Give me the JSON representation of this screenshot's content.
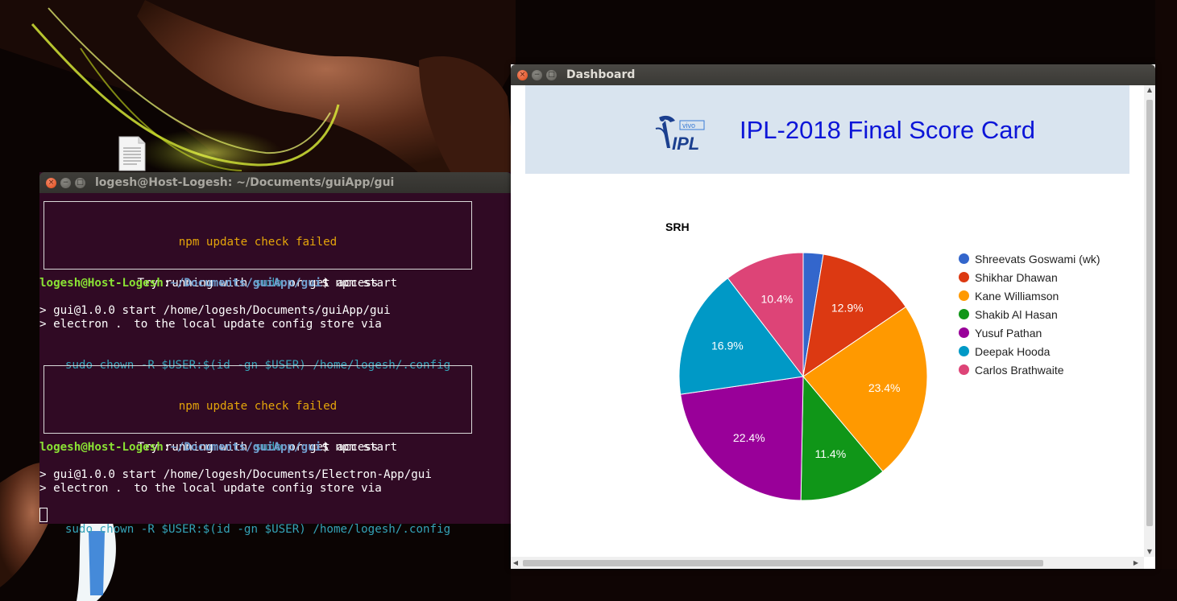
{
  "terminal": {
    "title": "logesh@Host-Logesh: ~/Documents/guiApp/gui",
    "npm_notice": {
      "line1": "npm update check failed",
      "line2_pre": "Try running with ",
      "line2_cmd": "sudo",
      "line2_post": " or get access",
      "line3": "to the local update config store via",
      "line4": "sudo chown -R $USER:$(id -gn $USER) /home/logesh/.config"
    },
    "prompt_user": "logesh@Host-Logesh",
    "prompt_sep": ":",
    "prompt_path": "~/Documents/guiApp/gui",
    "prompt_symbol": "$ npm start",
    "run1_line1": "> gui@1.0.0 start /home/logesh/Documents/guiApp/gui",
    "run1_line2": "> electron .",
    "run2_line1": "> gui@1.0.0 start /home/logesh/Documents/Electron-App/gui",
    "run2_line2": "> electron ."
  },
  "dashboard": {
    "title": "Dashboard",
    "page_title": "IPL-2018 Final Score Card",
    "logo": {
      "brand": "IPL",
      "sponsor": "vivo"
    }
  },
  "chart_data": {
    "type": "pie",
    "title": "SRH",
    "legend_position": "right",
    "series": [
      {
        "name": "Shreevats Goswami (wk)",
        "value": 2.6,
        "label": "",
        "color": "#3366cc"
      },
      {
        "name": "Shikhar Dhawan",
        "value": 12.9,
        "label": "12.9%",
        "color": "#dc3912"
      },
      {
        "name": "Kane Williamson",
        "value": 23.4,
        "label": "23.4%",
        "color": "#ff9900"
      },
      {
        "name": "Shakib Al Hasan",
        "value": 11.4,
        "label": "11.4%",
        "color": "#109618"
      },
      {
        "name": "Yusuf Pathan",
        "value": 22.4,
        "label": "22.4%",
        "color": "#990099"
      },
      {
        "name": "Deepak Hooda",
        "value": 16.9,
        "label": "16.9%",
        "color": "#0099c6"
      },
      {
        "name": "Carlos Brathwaite",
        "value": 10.4,
        "label": "10.4%",
        "color": "#dd4477"
      }
    ]
  },
  "icons": {
    "window_close": "×",
    "window_minimize": "−",
    "window_maximize": "□",
    "scroll_up": "▲",
    "scroll_down": "▼",
    "scroll_left": "◀",
    "scroll_right": "▶"
  }
}
